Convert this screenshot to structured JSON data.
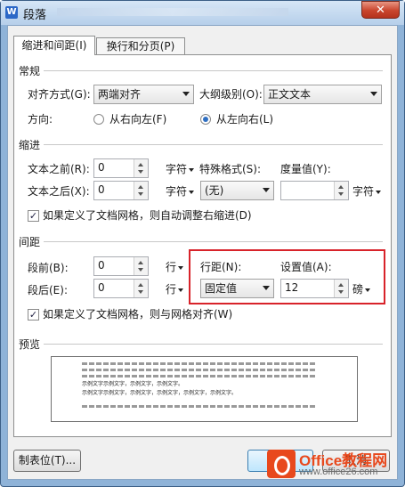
{
  "window": {
    "title": "段落",
    "app_icon": "W",
    "close_label": "✕"
  },
  "tabs": [
    {
      "label": "缩进和间距(I)",
      "active": true
    },
    {
      "label": "换行和分页(P)",
      "active": false
    }
  ],
  "general": {
    "heading": "常规",
    "align_label": "对齐方式(G):",
    "align_value": "两端对齐",
    "outline_label": "大纲级别(O):",
    "outline_value": "正文文本",
    "direction_label": "方向:",
    "rtl_label": "从右向左(F)",
    "ltr_label": "从左向右(L)",
    "ltr_selected": true
  },
  "indent": {
    "heading": "缩进",
    "before_label": "文本之前(R):",
    "before_value": "0",
    "before_unit": "字符",
    "after_label": "文本之后(X):",
    "after_value": "0",
    "after_unit": "字符",
    "special_label": "特殊格式(S):",
    "special_value": "(无)",
    "measure_label": "度量值(Y):",
    "measure_value": "",
    "measure_unit": "字符",
    "auto_adjust_label": "如果定义了文档网格，则自动调整右缩进(D)",
    "auto_adjust_checked": true
  },
  "spacing": {
    "heading": "间距",
    "before_label": "段前(B):",
    "before_value": "0",
    "before_unit": "行",
    "after_label": "段后(E):",
    "after_value": "0",
    "after_unit": "行",
    "line_label": "行距(N):",
    "line_value": "固定值",
    "set_label": "设置值(A):",
    "set_value": "12",
    "set_unit": "磅",
    "snap_grid_label": "如果定义了文档网格，则与网格对齐(W)",
    "snap_grid_checked": true
  },
  "preview": {
    "heading": "预览",
    "sample_line1": "示例文字示例文字，示例文字，示例文字。",
    "sample_line2": "示例文字示例文字，示例文字，示例文字，示例文字，示例文字。"
  },
  "buttons": {
    "tabs_label": "制表位(T)...",
    "ok_label": "确定",
    "cancel_label": "取消"
  },
  "watermark": {
    "brand": "Office教程网",
    "url": "www.office26.com"
  },
  "colors": {
    "highlight": "#d8232a",
    "title_bar": "#b6cfea",
    "watermark": "#e8491d"
  }
}
